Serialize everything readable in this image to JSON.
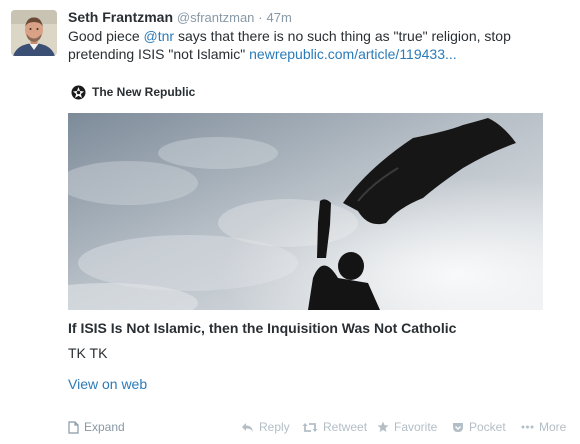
{
  "tweet": {
    "author_name": "Seth Frantzman",
    "author_handle": "@sfrantzman",
    "separator": "·",
    "time": "47m",
    "text_before_mention": "Good piece ",
    "mention": "@tnr",
    "text_after_mention": " says that there is no such thing as \"true\" religion, stop pretending ISIS \"not Islamic\" ",
    "link": "newrepublic.com/article/119433..."
  },
  "card": {
    "source_name": "The New Republic",
    "title": "If ISIS Is Not Islamic, then the Inquisition Was Not Catholic",
    "description": "TK TK",
    "view_on_web": "View on web"
  },
  "actions": {
    "expand": "Expand",
    "reply": "Reply",
    "retweet": "Retweet",
    "favorite": "Favorite",
    "pocket": "Pocket",
    "more": "More"
  },
  "colors": {
    "link_blue": "#2b7bb9",
    "muted_gray": "#8899a6",
    "action_gray": "#b3bec6",
    "text": "#292f33"
  }
}
